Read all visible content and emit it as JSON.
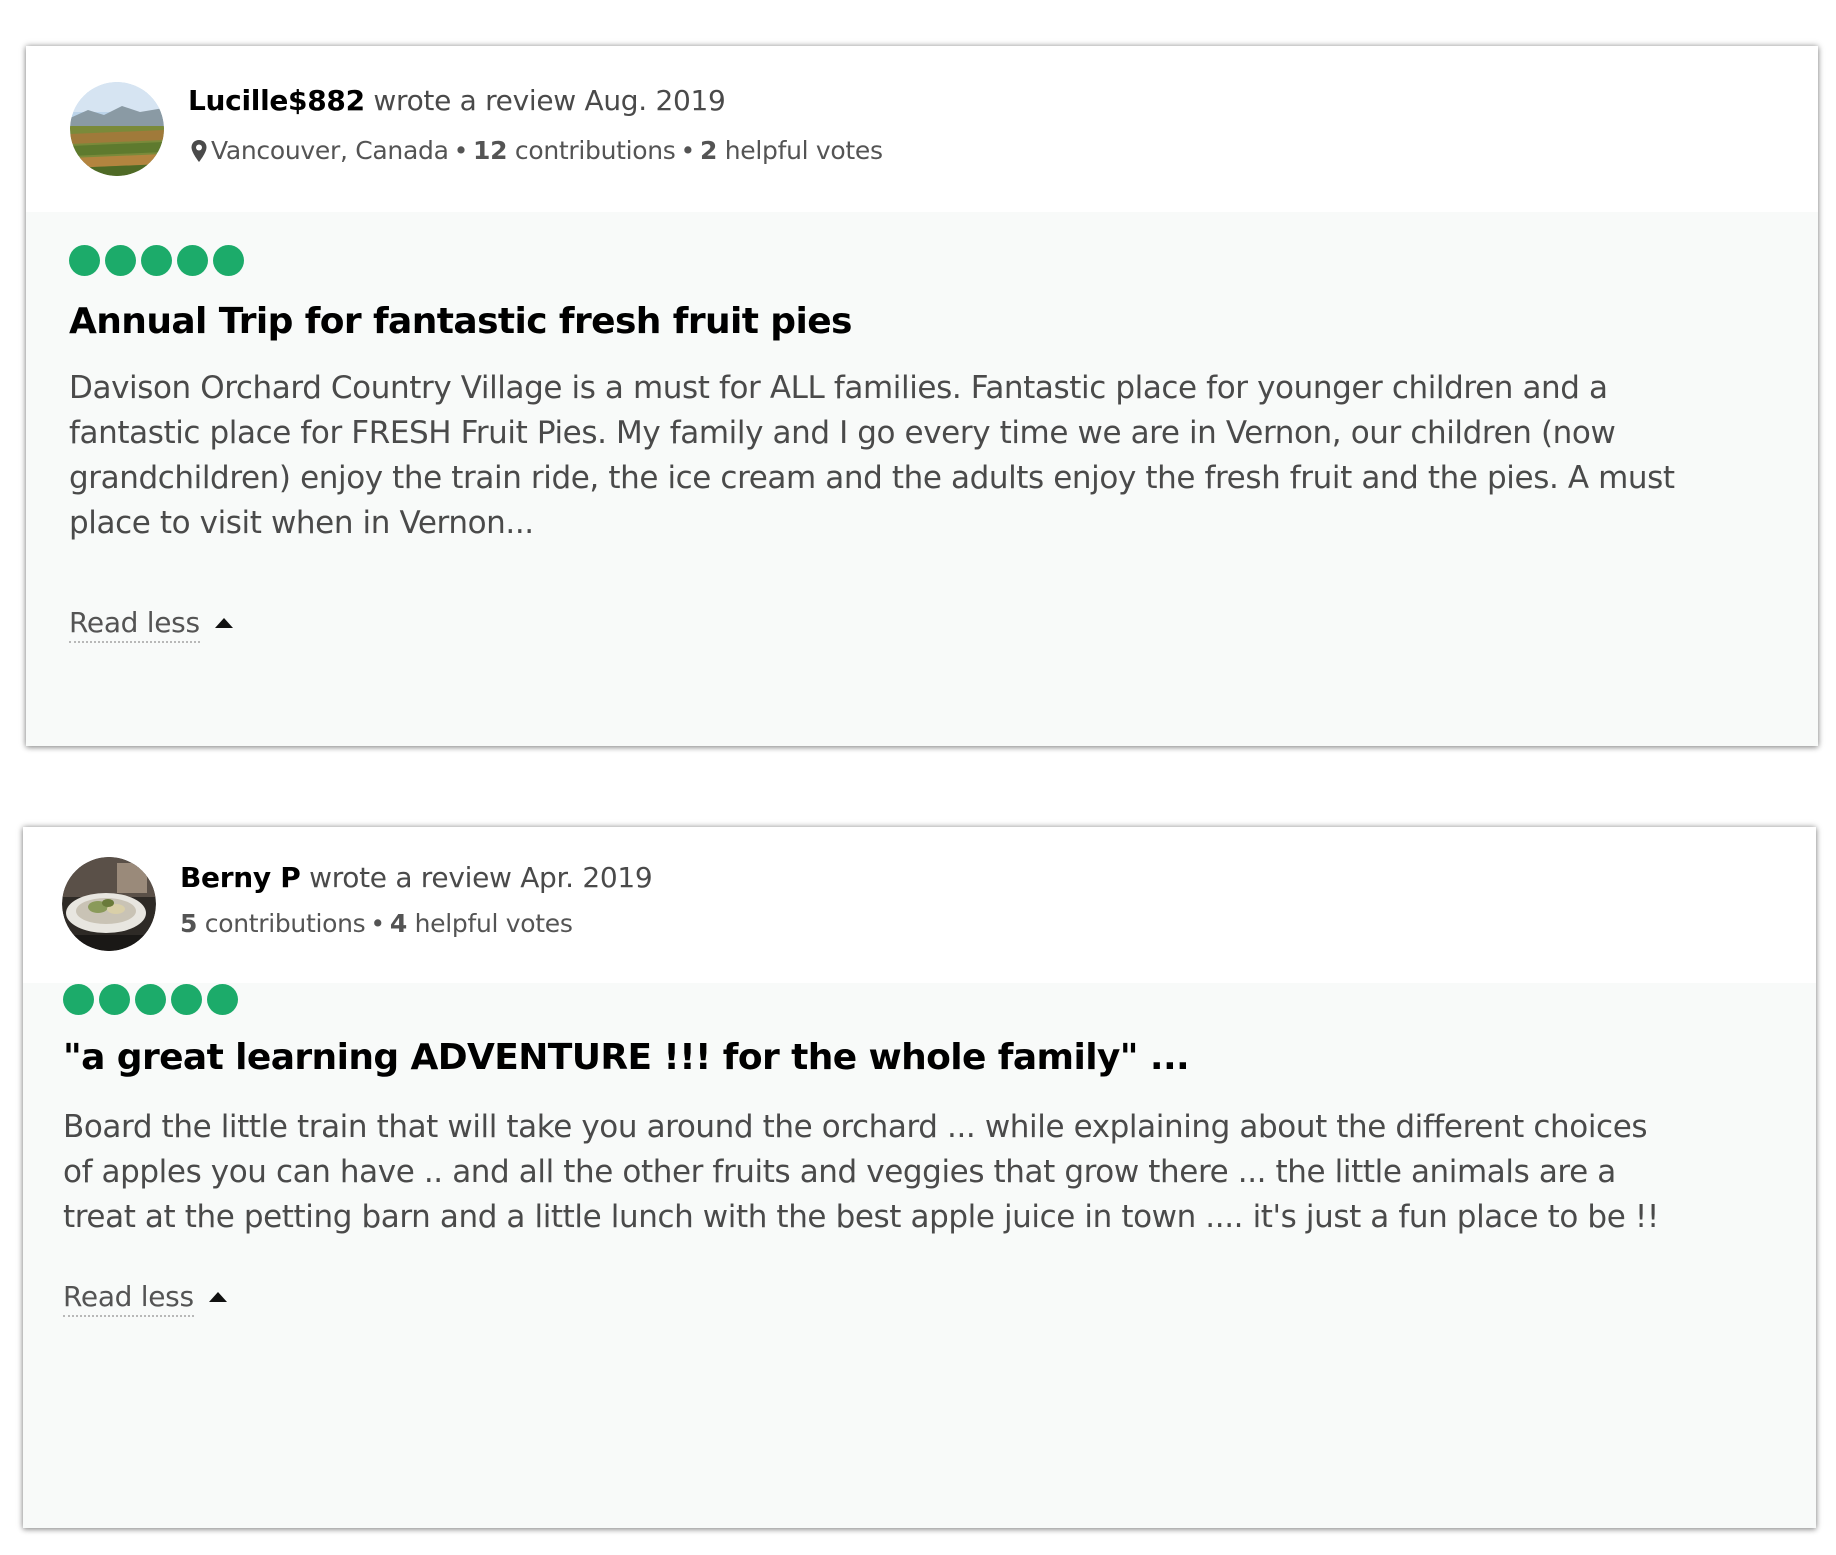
{
  "reviews": [
    {
      "author": "Lucille$882",
      "action": " wrote a review ",
      "date": "Aug. 2019",
      "location": "Vancouver, Canada",
      "contributions_count": "12",
      "contributions_label": " contributions",
      "helpful_count": "2",
      "helpful_label": " helpful votes",
      "rating": 5,
      "rating_max": 5,
      "title": "Annual Trip for fantastic fresh fruit pies",
      "body_lines": [
        "Davison Orchard Country Village is a must for ALL families. Fantastic place for younger children and a",
        "fantastic place for FRESH Fruit Pies. My family and I go every time we are in Vernon, our children (now",
        "grandchildren) enjoy the train ride, the ice cream and the adults enjoy the fresh fruit and the pies. A must",
        "place to visit when in Vernon..."
      ],
      "read_less_label": "Read less"
    },
    {
      "author": "Berny P",
      "action": " wrote a review ",
      "date": "Apr. 2019",
      "contributions_count": "5",
      "contributions_label": " contributions",
      "helpful_count": "4",
      "helpful_label": " helpful votes",
      "rating": 5,
      "rating_max": 5,
      "title": "\"a great learning ADVENTURE !!! for the whole family\" ...",
      "body_lines": [
        "Board the little train that will take you around the orchard ... while explaining about the different choices",
        "of apples you can have .. and all the other fruits and veggies that grow there ... the little animals are a",
        "treat at the petting barn and a little lunch with the best apple juice in town .... it's just a fun place to be !!"
      ],
      "read_less_label": "Read less"
    }
  ],
  "separator": "•",
  "colors": {
    "rating_bubble": "#1cab6a",
    "card_background": "#f8faf9",
    "header_background": "#ffffff",
    "body_text": "#4a4a4a",
    "meta_text": "#545454"
  },
  "icons": {
    "location": "map-pin-icon",
    "expand_toggle": "caret-up-icon"
  }
}
